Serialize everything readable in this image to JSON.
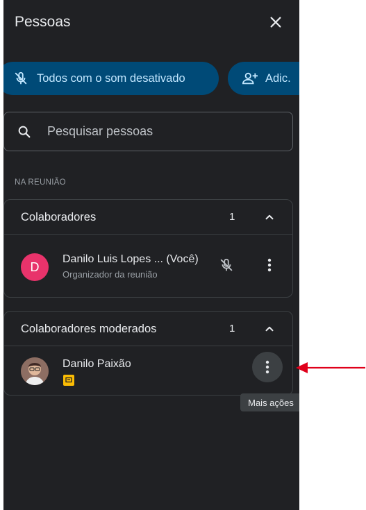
{
  "panel": {
    "title": "Pessoas",
    "close_icon": "close-icon"
  },
  "actions": {
    "mute_all_label": "Todos com o som desativado",
    "mute_all_icon": "mic-off-icon",
    "add_label": "Adic.",
    "add_icon": "person-add-icon"
  },
  "search": {
    "placeholder": "Pesquisar pessoas",
    "value": "",
    "icon": "search-icon"
  },
  "section_label": "NA REUNIÃO",
  "groups": [
    {
      "title": "Colaboradores",
      "count": "1",
      "expanded": true,
      "members": [
        {
          "name": "Danilo Luis Lopes ... (Você)",
          "subtitle": "Organizador da reunião",
          "avatar_letter": "D",
          "avatar_color": "#e8336b",
          "status_icon": "mic-off-icon",
          "more_icon": "more-vert-icon"
        }
      ]
    },
    {
      "title": "Colaboradores moderados",
      "count": "1",
      "expanded": true,
      "members": [
        {
          "name": "Danilo Paixão",
          "avatar": "photo",
          "badge_icon": "presentation-badge-icon",
          "badge_color": "#fbbc04",
          "more_icon": "more-vert-icon"
        }
      ]
    }
  ],
  "tooltip": "Mais ações",
  "annotation": {
    "arrow_color": "#e0001b"
  },
  "colors": {
    "panel_bg": "#202124",
    "pill_bg": "#004a77",
    "pill_text": "#c2e7ff",
    "border": "#3c4043"
  }
}
